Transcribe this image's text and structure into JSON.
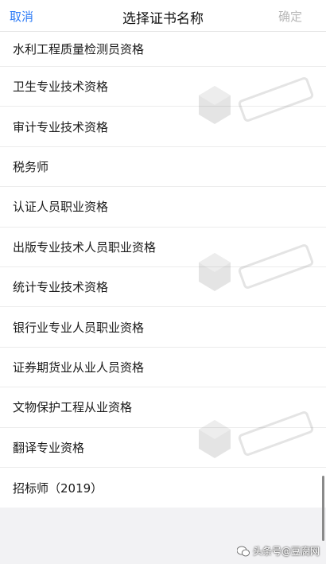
{
  "nav": {
    "cancel_label": "取消",
    "title": "选择证书名称",
    "confirm_label": "确定"
  },
  "list": {
    "items": [
      "水利工程质量检测员资格",
      "卫生专业技术资格",
      "审计专业技术资格",
      "税务师",
      "认证人员职业资格",
      "出版专业技术人员职业资格",
      "统计专业技术资格",
      "银行业专业人员职业资格",
      "证券期货业从业人员资格",
      "文物保护工程从业资格",
      "翻译专业资格",
      "招标师（2019）"
    ]
  },
  "footer": {
    "watermark_text": "头条号@豆腐网"
  },
  "colors": {
    "accent": "#2e7cf6",
    "disabled": "#b8b8b8"
  }
}
